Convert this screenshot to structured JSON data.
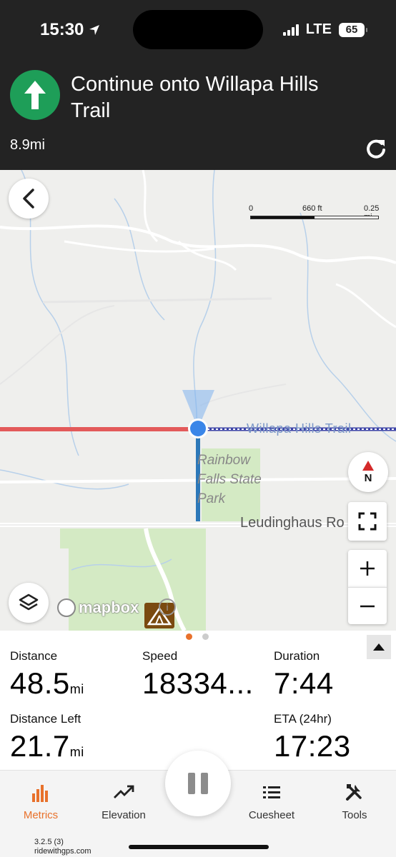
{
  "status_bar": {
    "time": "15:30",
    "network": "LTE",
    "battery": "65"
  },
  "navigation": {
    "instruction": "Continue onto Willapa Hills Trail",
    "distance_to_turn": "8.9mi"
  },
  "map": {
    "scale": {
      "start": "0",
      "mid": "660 ft",
      "end": "0.25 mi"
    },
    "labels": {
      "trail": "Willapa Hills Trail",
      "park": "Rainbow Falls State Park",
      "road": "Leudinghaus Ro"
    },
    "compass_letter": "N",
    "attribution": "mapbox",
    "info": "i"
  },
  "metrics": {
    "distance": {
      "label": "Distance",
      "value": "48.5",
      "unit": "mi"
    },
    "speed": {
      "label": "Speed",
      "value": "18334..."
    },
    "duration": {
      "label": "Duration",
      "value": "7:44"
    },
    "distance_left": {
      "label": "Distance Left",
      "value": "21.7",
      "unit": "mi"
    },
    "eta": {
      "label": "ETA (24hr)",
      "value": "17:23"
    }
  },
  "tabs": [
    {
      "label": "Metrics",
      "icon": "bar-chart-icon",
      "active": true
    },
    {
      "label": "Elevation",
      "icon": "trend-line-icon"
    },
    {
      "label": "Cuesheet",
      "icon": "list-icon"
    },
    {
      "label": "Tools",
      "icon": "tools-icon"
    }
  ],
  "footer": {
    "version": "3.2.5 (3)",
    "site": "ridewithgps.com"
  },
  "colors": {
    "accent": "#e8712b",
    "turn_green": "#1e9e58",
    "route_red": "#e35a5a",
    "position_blue": "#3a86e8"
  }
}
